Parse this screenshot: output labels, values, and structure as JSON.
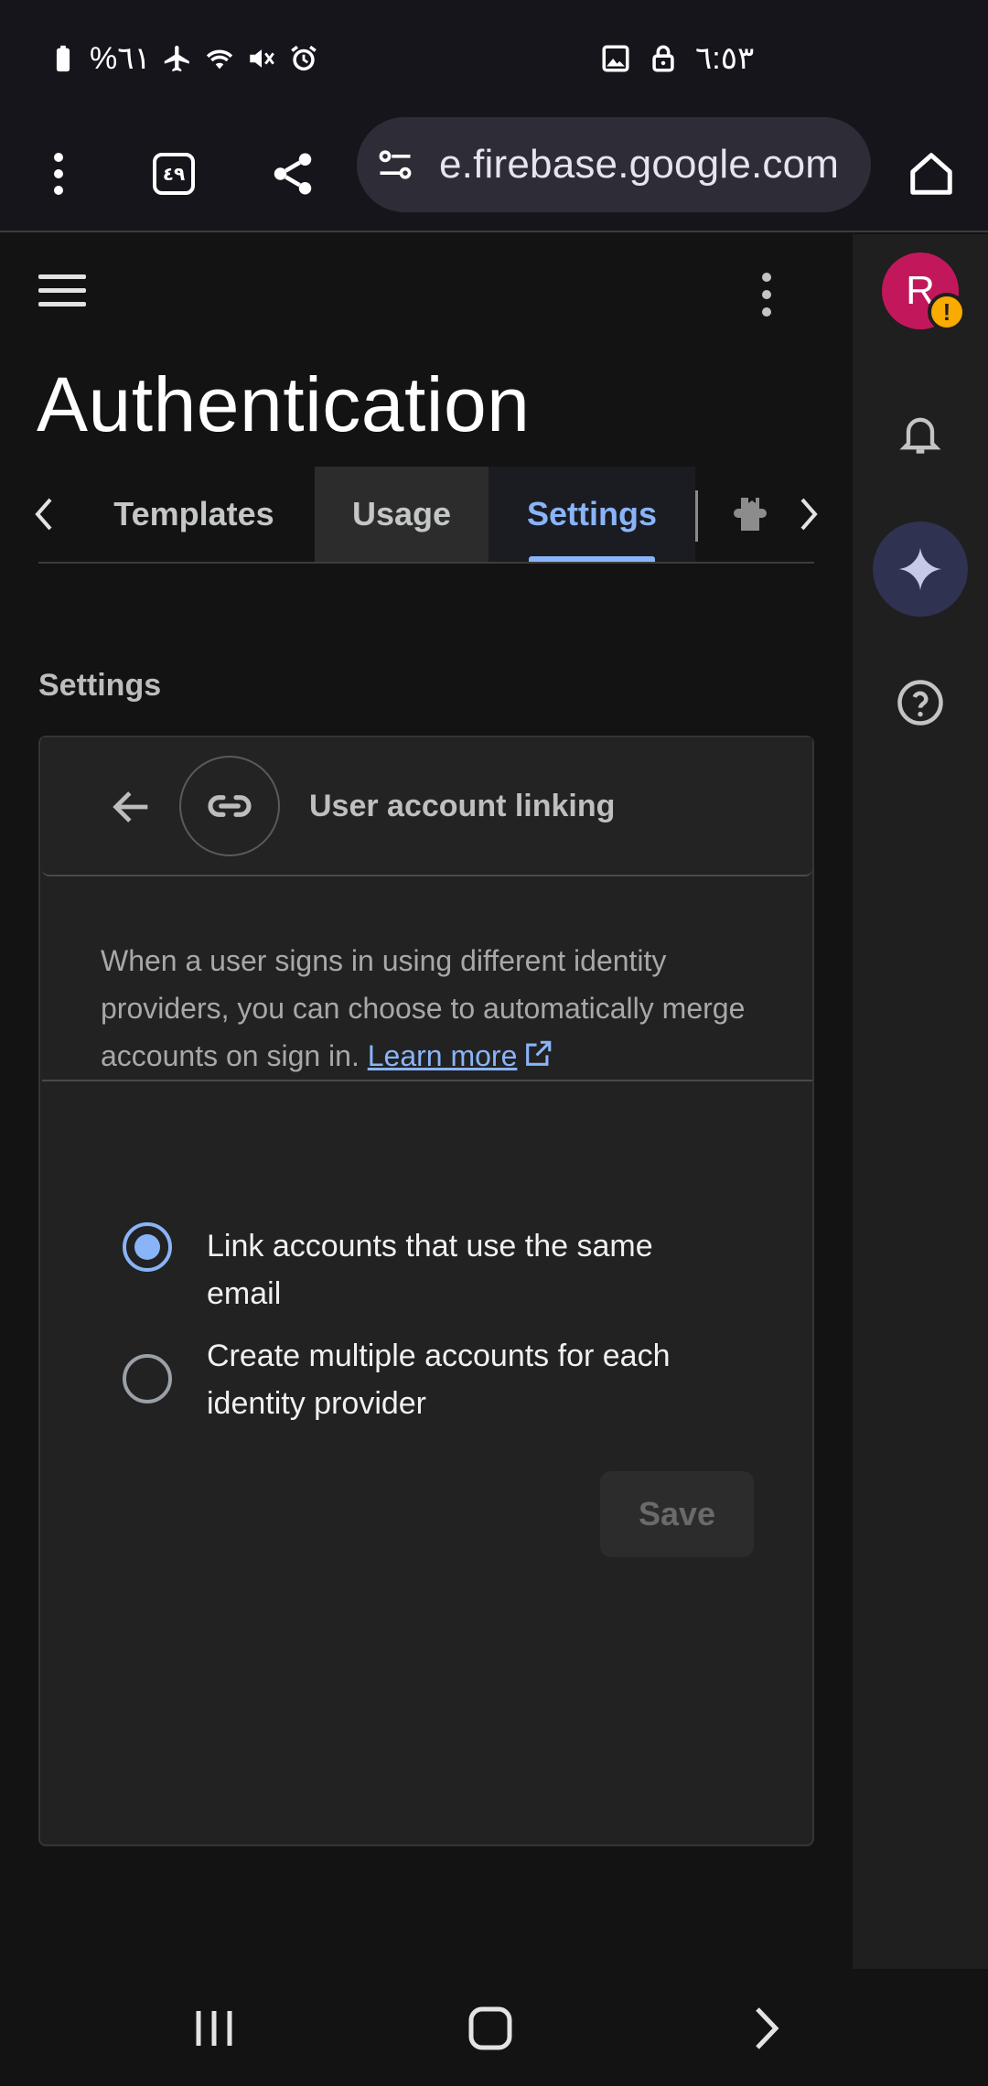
{
  "status_bar": {
    "battery_text": "%٦١",
    "time": "٦:٥٣",
    "icons": [
      "battery-icon",
      "airplane-icon",
      "wifi-icon",
      "mute-icon",
      "alarm-icon",
      "gallery-icon",
      "lock-icon"
    ]
  },
  "browser": {
    "url": "e.firebase.google.com",
    "tab_count": "٤٩",
    "icons": [
      "menu-dots-icon",
      "tab-switcher-icon",
      "share-icon",
      "site-settings-icon",
      "home-icon"
    ]
  },
  "header": {
    "title": "Authentication"
  },
  "tabs": {
    "items": [
      {
        "label": "Templates"
      },
      {
        "label": "Usage"
      },
      {
        "label": "Settings"
      }
    ],
    "active_color": "#8ab4f8"
  },
  "settings": {
    "section_label": "Settings",
    "card": {
      "title": "User account linking",
      "description": "When a user signs in using different identity providers, you can choose to automatically merge accounts on sign in.",
      "learn_more": "Learn more",
      "options": [
        {
          "label": "Link accounts that use the same email",
          "selected": true
        },
        {
          "label": "Create multiple accounts for each identity provider",
          "selected": false
        }
      ],
      "save_label": "Save"
    }
  },
  "rail": {
    "avatar_letter": "R",
    "avatar_color": "#c2185b",
    "warning_badge": "!",
    "icons": [
      "notifications-icon",
      "gemini-icon",
      "help-icon"
    ]
  },
  "nav": {
    "icons": [
      "recents-icon",
      "home-button-icon",
      "back-icon"
    ]
  }
}
